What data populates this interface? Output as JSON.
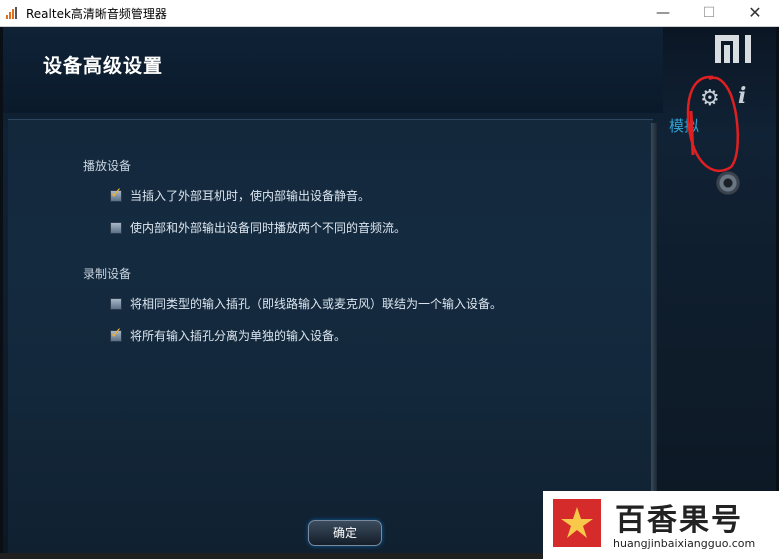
{
  "window": {
    "title": "Realtek高清晰音频管理器",
    "minimize_glyph": "—",
    "maximize_glyph": "☐",
    "close_glyph": "✕"
  },
  "header": {
    "page_title": "设备高级设置",
    "brand_logo": "mi-logo",
    "settings_icon": "gear-icon",
    "settings_glyph": "⚙",
    "info_icon": "info-icon",
    "info_glyph": "i",
    "tab_label": "模拟"
  },
  "playback": {
    "title": "播放设备",
    "options": [
      {
        "label": "当插入了外部耳机时，使内部输出设备静音。",
        "checked": true
      },
      {
        "label": "使内部和外部输出设备同时播放两个不同的音频流。",
        "checked": false
      }
    ]
  },
  "recording": {
    "title": "录制设备",
    "options": [
      {
        "label": "将相同类型的输入插孔（即线路输入或麦克风）联结为一个输入设备。",
        "checked": false
      },
      {
        "label": "将所有输入插孔分离为单独的输入设备。",
        "checked": true
      }
    ]
  },
  "ok_button": "确定",
  "watermark": {
    "text": "百香果号",
    "url": "huangjinbaixiangguo.com"
  },
  "colors": {
    "accent_check": "#f0b030",
    "tab_text": "#30a0d0",
    "annotation": "#e02020"
  }
}
